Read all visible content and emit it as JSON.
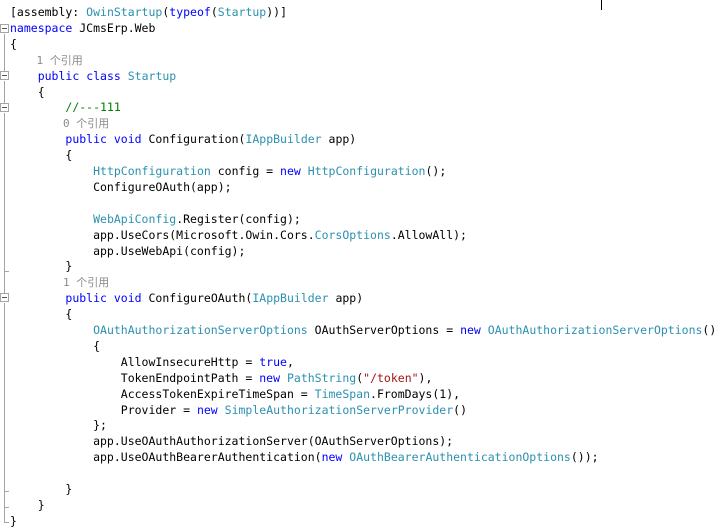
{
  "editor": {
    "lines": [
      {
        "id": "l1",
        "parts": [
          {
            "c": "",
            "t": "[assembly: "
          },
          {
            "c": "ty",
            "t": "OwinStartup"
          },
          {
            "c": "",
            "t": "("
          },
          {
            "c": "kw",
            "t": "typeof"
          },
          {
            "c": "",
            "t": "("
          },
          {
            "c": "ty",
            "t": "Startup"
          },
          {
            "c": "",
            "t": "))]"
          }
        ]
      },
      {
        "id": "l2",
        "parts": [
          {
            "c": "kw",
            "t": "namespace"
          },
          {
            "c": "",
            "t": " JCmsErp.Web"
          }
        ]
      },
      {
        "id": "l3",
        "parts": [
          {
            "c": "",
            "t": "{"
          }
        ]
      },
      {
        "id": "l4",
        "parts": [
          {
            "c": "lens",
            "t": "    1 个引用"
          }
        ]
      },
      {
        "id": "l5",
        "parts": [
          {
            "c": "",
            "t": "    "
          },
          {
            "c": "kw",
            "t": "public"
          },
          {
            "c": "",
            "t": " "
          },
          {
            "c": "kw",
            "t": "class"
          },
          {
            "c": "",
            "t": " "
          },
          {
            "c": "ty",
            "t": "Startup"
          }
        ]
      },
      {
        "id": "l6",
        "parts": [
          {
            "c": "",
            "t": "    {"
          }
        ]
      },
      {
        "id": "l7",
        "parts": [
          {
            "c": "",
            "t": "        "
          },
          {
            "c": "cm",
            "t": "//---111"
          }
        ]
      },
      {
        "id": "l8",
        "parts": [
          {
            "c": "lens",
            "t": "        0 个引用"
          }
        ]
      },
      {
        "id": "l9",
        "parts": [
          {
            "c": "",
            "t": "        "
          },
          {
            "c": "kw",
            "t": "public"
          },
          {
            "c": "",
            "t": " "
          },
          {
            "c": "kw",
            "t": "void"
          },
          {
            "c": "",
            "t": " Configuration("
          },
          {
            "c": "ty",
            "t": "IAppBuilder"
          },
          {
            "c": "",
            "t": " app)"
          }
        ]
      },
      {
        "id": "l10",
        "parts": [
          {
            "c": "",
            "t": "        {"
          }
        ]
      },
      {
        "id": "l11",
        "parts": [
          {
            "c": "",
            "t": "            "
          },
          {
            "c": "ty",
            "t": "HttpConfiguration"
          },
          {
            "c": "",
            "t": " config = "
          },
          {
            "c": "kw",
            "t": "new"
          },
          {
            "c": "",
            "t": " "
          },
          {
            "c": "ty",
            "t": "HttpConfiguration"
          },
          {
            "c": "",
            "t": "();"
          }
        ]
      },
      {
        "id": "l12",
        "parts": [
          {
            "c": "",
            "t": "            ConfigureOAuth(app);"
          }
        ]
      },
      {
        "id": "l13",
        "parts": [
          {
            "c": "",
            "t": ""
          }
        ]
      },
      {
        "id": "l14",
        "parts": [
          {
            "c": "",
            "t": "            "
          },
          {
            "c": "ty",
            "t": "WebApiConfig"
          },
          {
            "c": "",
            "t": ".Register(config);"
          }
        ]
      },
      {
        "id": "l15",
        "parts": [
          {
            "c": "",
            "t": "            app.UseCors(Microsoft.Owin.Cors."
          },
          {
            "c": "ty",
            "t": "CorsOptions"
          },
          {
            "c": "",
            "t": ".AllowAll);"
          }
        ]
      },
      {
        "id": "l16",
        "parts": [
          {
            "c": "",
            "t": "            app.UseWebApi(config);"
          }
        ]
      },
      {
        "id": "l17",
        "parts": [
          {
            "c": "",
            "t": "        }"
          }
        ]
      },
      {
        "id": "l18",
        "parts": [
          {
            "c": "lens",
            "t": "        1 个引用"
          }
        ]
      },
      {
        "id": "l19",
        "parts": [
          {
            "c": "",
            "t": "        "
          },
          {
            "c": "kw",
            "t": "public"
          },
          {
            "c": "",
            "t": " "
          },
          {
            "c": "kw",
            "t": "void"
          },
          {
            "c": "",
            "t": " ConfigureOAuth("
          },
          {
            "c": "ty",
            "t": "IAppBuilder"
          },
          {
            "c": "",
            "t": " app)"
          }
        ]
      },
      {
        "id": "l20",
        "parts": [
          {
            "c": "",
            "t": "        {"
          }
        ]
      },
      {
        "id": "l21",
        "parts": [
          {
            "c": "",
            "t": "            "
          },
          {
            "c": "ty",
            "t": "OAuthAuthorizationServerOptions"
          },
          {
            "c": "",
            "t": " OAuthServerOptions = "
          },
          {
            "c": "kw",
            "t": "new"
          },
          {
            "c": "",
            "t": " "
          },
          {
            "c": "ty",
            "t": "OAuthAuthorizationServerOptions"
          },
          {
            "c": "",
            "t": "()"
          }
        ]
      },
      {
        "id": "l22",
        "parts": [
          {
            "c": "",
            "t": "            {"
          }
        ]
      },
      {
        "id": "l23",
        "parts": [
          {
            "c": "",
            "t": "                AllowInsecureHttp = "
          },
          {
            "c": "kw",
            "t": "true"
          },
          {
            "c": "",
            "t": ","
          }
        ]
      },
      {
        "id": "l24",
        "parts": [
          {
            "c": "",
            "t": "                TokenEndpointPath = "
          },
          {
            "c": "kw",
            "t": "new"
          },
          {
            "c": "",
            "t": " "
          },
          {
            "c": "ty",
            "t": "PathString"
          },
          {
            "c": "",
            "t": "("
          },
          {
            "c": "st",
            "t": "\"/token\""
          },
          {
            "c": "",
            "t": "),"
          }
        ]
      },
      {
        "id": "l25",
        "parts": [
          {
            "c": "",
            "t": "                AccessTokenExpireTimeSpan = "
          },
          {
            "c": "ty",
            "t": "TimeSpan"
          },
          {
            "c": "",
            "t": ".FromDays(1),"
          }
        ]
      },
      {
        "id": "l26",
        "parts": [
          {
            "c": "",
            "t": "                Provider = "
          },
          {
            "c": "kw",
            "t": "new"
          },
          {
            "c": "",
            "t": " "
          },
          {
            "c": "ty",
            "t": "SimpleAuthorizationServerProvider"
          },
          {
            "c": "",
            "t": "()"
          }
        ]
      },
      {
        "id": "l27",
        "parts": [
          {
            "c": "",
            "t": "            };"
          }
        ]
      },
      {
        "id": "l28",
        "parts": [
          {
            "c": "",
            "t": "            app.UseOAuthAuthorizationServer(OAuthServerOptions);"
          }
        ]
      },
      {
        "id": "l29",
        "parts": [
          {
            "c": "",
            "t": "            app.UseOAuthBearerAuthentication("
          },
          {
            "c": "kw",
            "t": "new"
          },
          {
            "c": "",
            "t": " "
          },
          {
            "c": "ty",
            "t": "OAuthBearerAuthenticationOptions"
          },
          {
            "c": "",
            "t": "());"
          }
        ]
      },
      {
        "id": "l30",
        "parts": [
          {
            "c": "",
            "t": ""
          }
        ]
      },
      {
        "id": "l31",
        "parts": [
          {
            "c": "",
            "t": "        }"
          }
        ]
      },
      {
        "id": "l32",
        "parts": [
          {
            "c": "",
            "t": "    }"
          }
        ]
      },
      {
        "id": "l33",
        "parts": [
          {
            "c": "",
            "t": "}"
          }
        ]
      }
    ]
  }
}
